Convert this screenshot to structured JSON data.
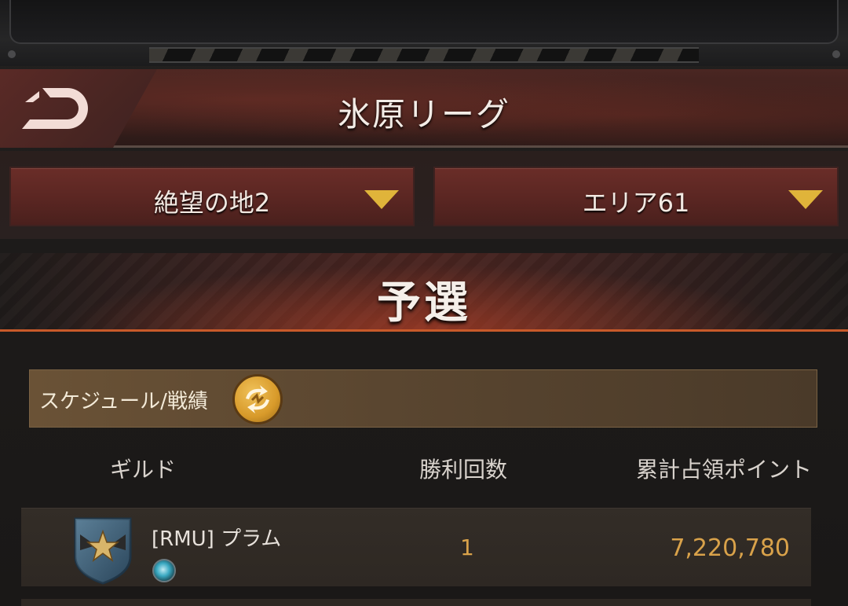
{
  "header": {
    "title": "氷原リーグ",
    "back_icon": "back-arrow-icon"
  },
  "selectors": {
    "left_label": "絶望の地2",
    "right_label": "エリア61",
    "arrow_color": "#e0b43a"
  },
  "stage": {
    "title": "予選"
  },
  "schedule": {
    "label": "スケジュール/戦績",
    "icon": "swap-arrows-icon"
  },
  "table": {
    "headers": {
      "guild": "ギルド",
      "wins": "勝利回数",
      "points": "累計占領ポイント"
    },
    "rows": [
      {
        "guild_name": "[RMU] プラム",
        "wins": "1",
        "points": "7,220,780",
        "emblem_icon": "star-wings-emblem-icon",
        "badge_icon": "orb-badge-icon"
      }
    ]
  },
  "colors": {
    "accent_gold": "#d9a24a",
    "header_red": "#5a2622",
    "schedule_brown": "#5a4630"
  }
}
